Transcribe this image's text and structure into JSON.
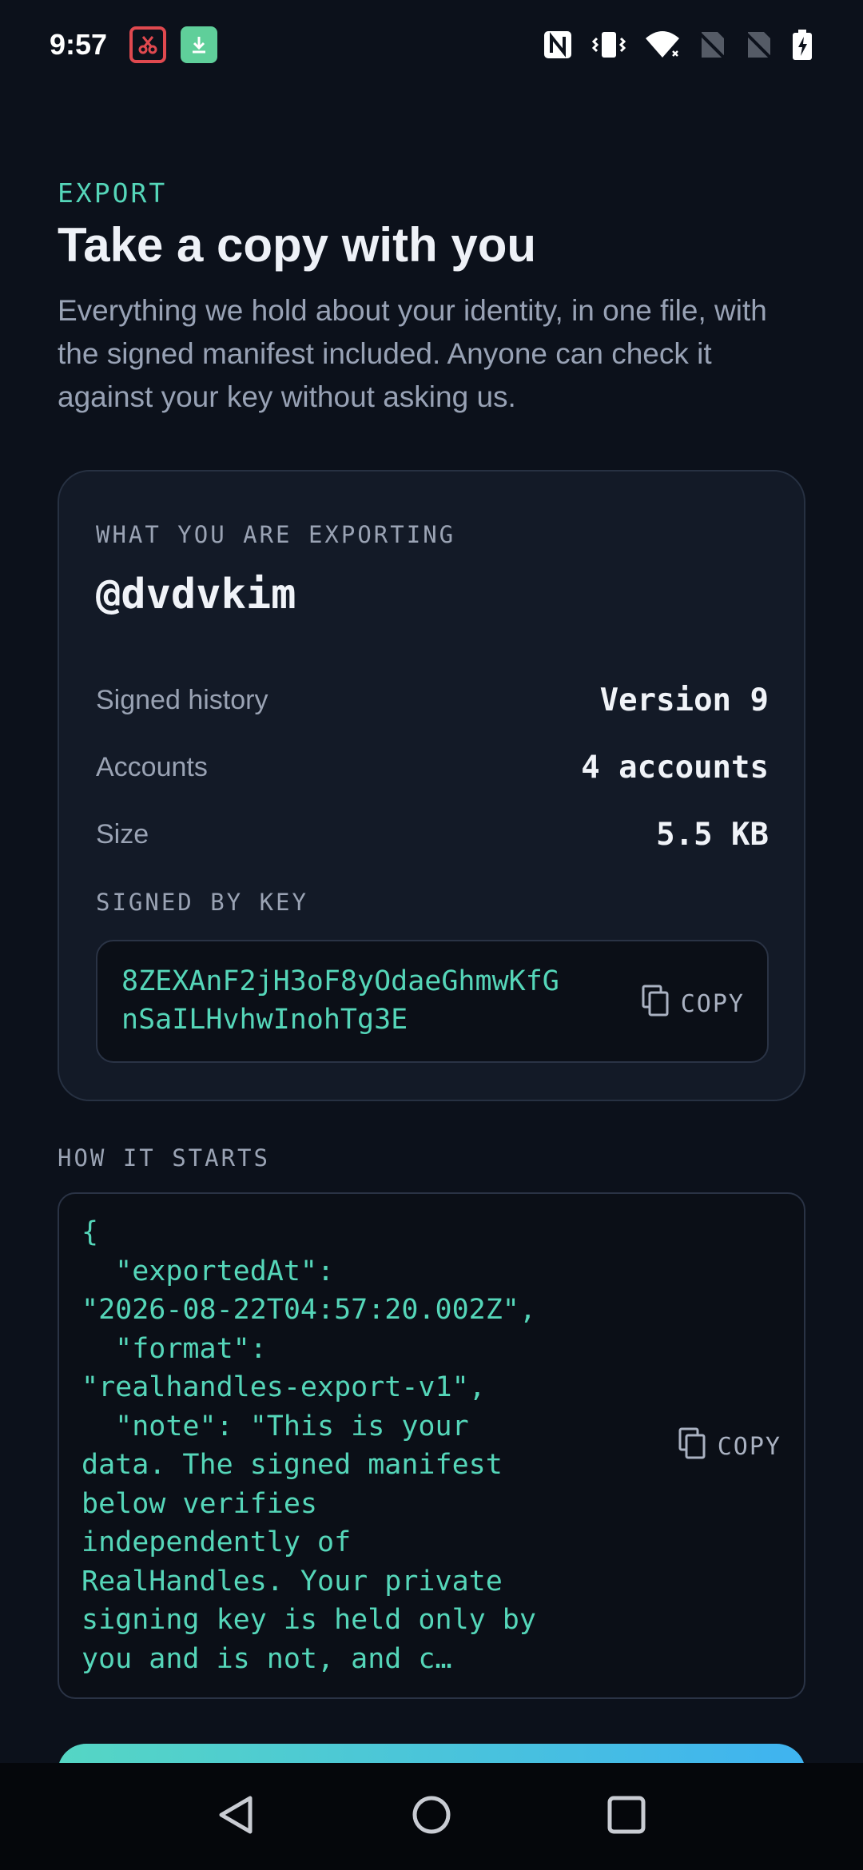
{
  "status_bar": {
    "time": "9:57",
    "left_icons": [
      "screenshot-icon",
      "download-icon"
    ],
    "right_icons": [
      "nfc-icon",
      "vibrate-icon",
      "wifi-icon",
      "no-sim-icon",
      "no-sim-icon",
      "battery-charging-icon"
    ]
  },
  "header": {
    "eyebrow": "EXPORT",
    "title": "Take a copy with you",
    "description": "Everything we hold about your identity, in one file, with the signed manifest included. Anyone can check it against your key without asking us."
  },
  "summary_card": {
    "label": "WHAT YOU ARE EXPORTING",
    "handle": "@dvdvkim",
    "rows": [
      {
        "key": "Signed history",
        "value": "Version 9"
      },
      {
        "key": "Accounts",
        "value": "4 accounts"
      },
      {
        "key": "Size",
        "value": "5.5 KB"
      }
    ],
    "signed_by_label": "SIGNED BY KEY",
    "key_value": "8ZEXAnF2jH3oF8yOdaeGhmwKfGnSaILHvhwInohTg3E",
    "copy_label": "COPY"
  },
  "preview": {
    "label": "HOW IT STARTS",
    "code": "{\n  \"exportedAt\":\n\"2026-08-22T04:57:20.002Z\",\n  \"format\":\n\"realhandles-export-v1\",\n  \"note\": \"This is your\ndata. The signed manifest\nbelow verifies\nindependently of\nRealHandles. Your private\nsigning key is held only by\nyou and is not, and c…",
    "copy_label": "COPY"
  },
  "nav": {
    "icons": [
      "back-icon",
      "home-icon",
      "recents-icon"
    ]
  },
  "colors": {
    "background": "#0c111b",
    "accent": "#55d6b9",
    "card": "#131a27",
    "gradient_start": "#55d6c4",
    "gradient_end": "#3fb3f0"
  }
}
